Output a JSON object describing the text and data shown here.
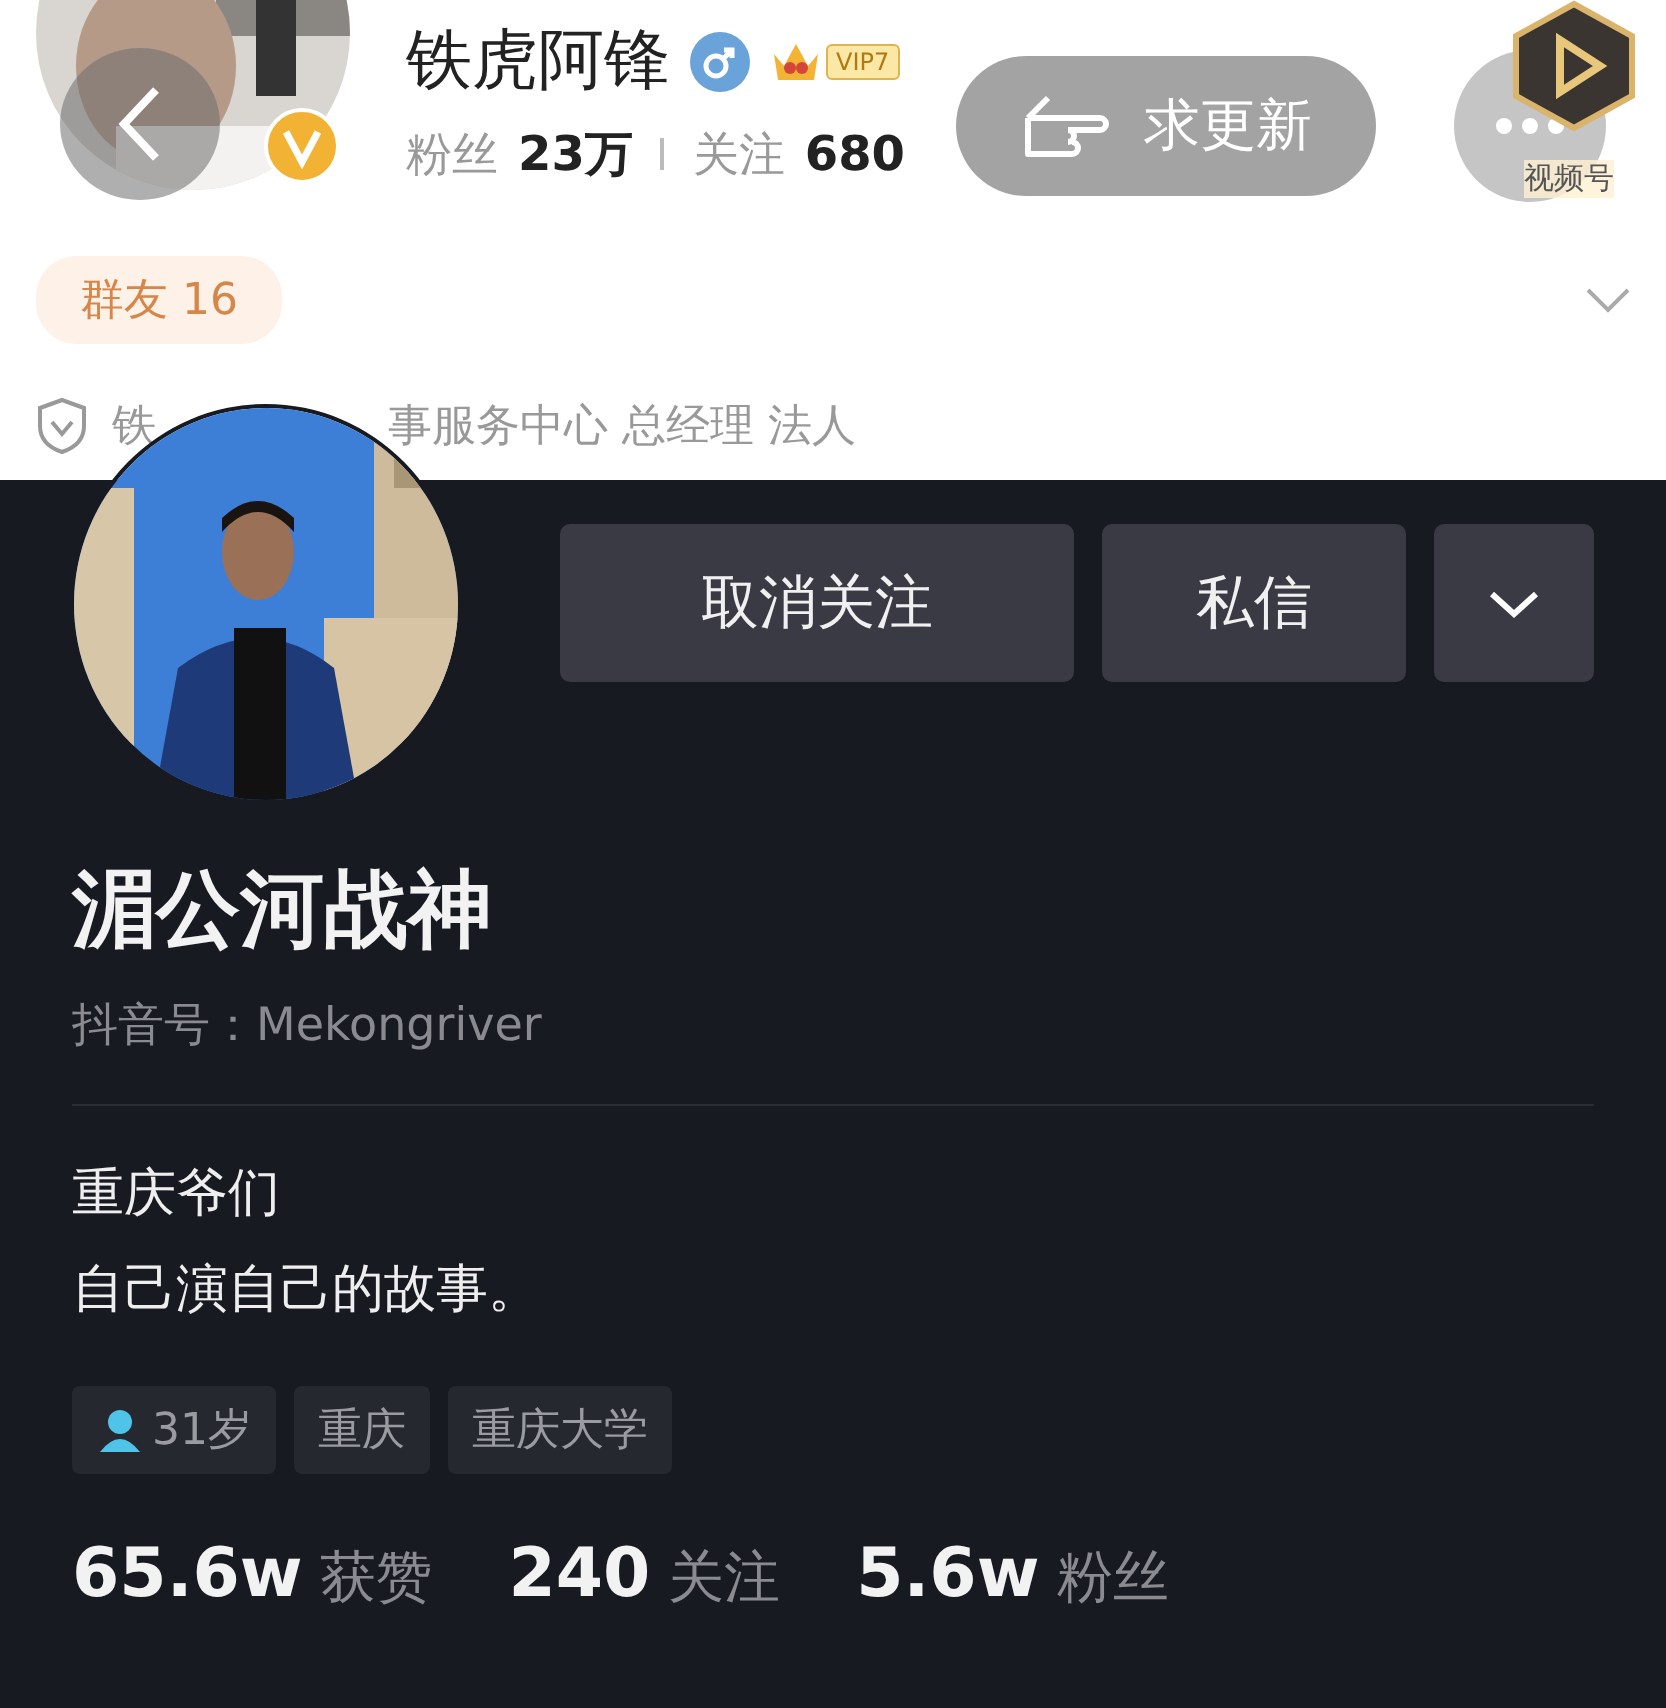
{
  "weibo": {
    "name": "铁虎阿锋",
    "vip_badge": "VIP7",
    "stats": [
      {
        "label": "粉丝",
        "value": "23万"
      },
      {
        "label": "关注",
        "value": "680"
      }
    ],
    "update_button": "求更新",
    "video_label": "视频号",
    "group_badge": "群友 16",
    "verification_parts": [
      "铁",
      "事服务中心 总经理 法人"
    ]
  },
  "douyin": {
    "buttons": [
      "取消关注",
      "私信"
    ],
    "name": "湄公河战神",
    "id_line": "抖音号：Mekongriver",
    "bio": [
      "重庆爷们",
      "自己演自己的故事。"
    ],
    "tags": [
      {
        "kind": "age",
        "text": "31岁"
      },
      {
        "kind": "plain",
        "text": "重庆"
      },
      {
        "kind": "plain",
        "text": "重庆大学"
      }
    ],
    "stats": [
      "**65.6w** 获赞",
      "**240** 关注",
      "**5.6w** 粉丝"
    ]
  }
}
